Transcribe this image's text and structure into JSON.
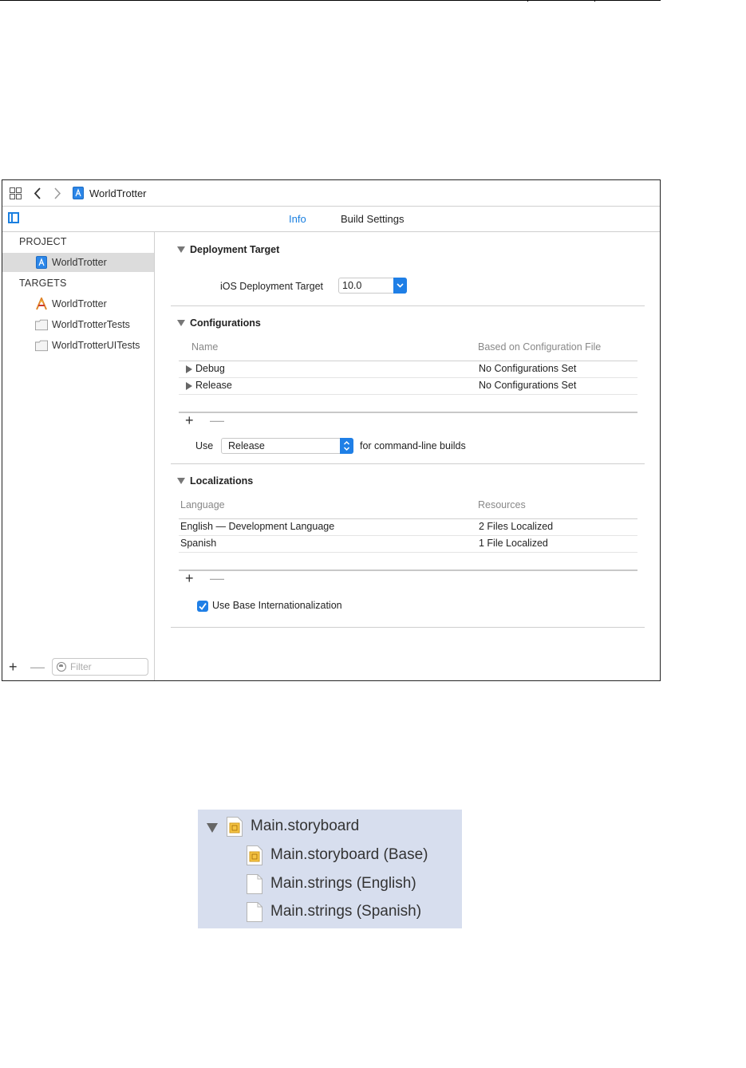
{
  "window": {
    "title": "WorldTrotter",
    "tabs": [
      {
        "label": "Info",
        "selected": true
      },
      {
        "label": "Build Settings",
        "selected": false
      }
    ]
  },
  "sidebar": {
    "project_header": "PROJECT",
    "project_item": "WorldTrotter",
    "targets_header": "TARGETS",
    "targets": [
      {
        "label": "WorldTrotter",
        "icon": "app-target-icon"
      },
      {
        "label": "WorldTrotterTests",
        "icon": "test-bundle-icon"
      },
      {
        "label": "WorldTrotterUITests",
        "icon": "test-bundle-icon"
      }
    ],
    "add_symbol": "+",
    "remove_symbol": "—",
    "filter_placeholder": "Filter"
  },
  "deployment": {
    "title": "Deployment Target",
    "label": "iOS Deployment Target",
    "value": "10.0"
  },
  "configurations": {
    "title": "Configurations",
    "columns": [
      "Name",
      "Based on Configuration File"
    ],
    "rows": [
      {
        "name": "Debug",
        "file": "No Configurations Set"
      },
      {
        "name": "Release",
        "file": "No Configurations Set"
      }
    ],
    "add_symbol": "+",
    "remove_symbol": "—",
    "use_label": "Use",
    "use_value": "Release",
    "use_suffix": "for command-line builds"
  },
  "localizations": {
    "title": "Localizations",
    "columns": [
      "Language",
      "Resources"
    ],
    "rows": [
      {
        "language": "English — Development Language",
        "resources": "2 Files Localized"
      },
      {
        "language": "Spanish",
        "resources": "1 File Localized"
      }
    ],
    "add_symbol": "+",
    "remove_symbol": "—",
    "base_intl_label": "Use Base Internationalization",
    "base_intl_checked": true
  },
  "file_tree": {
    "root": "Main.storyboard",
    "children": [
      {
        "label": "Main.storyboard (Base)",
        "icon": "storyboard-file-icon"
      },
      {
        "label": "Main.strings (English)",
        "icon": "strings-file-icon"
      },
      {
        "label": "Main.strings (Spanish)",
        "icon": "strings-file-icon"
      }
    ]
  },
  "colors": {
    "accent": "#1a7fe0",
    "selection": "#dcdcdc",
    "tree_background": "#d7deee"
  }
}
